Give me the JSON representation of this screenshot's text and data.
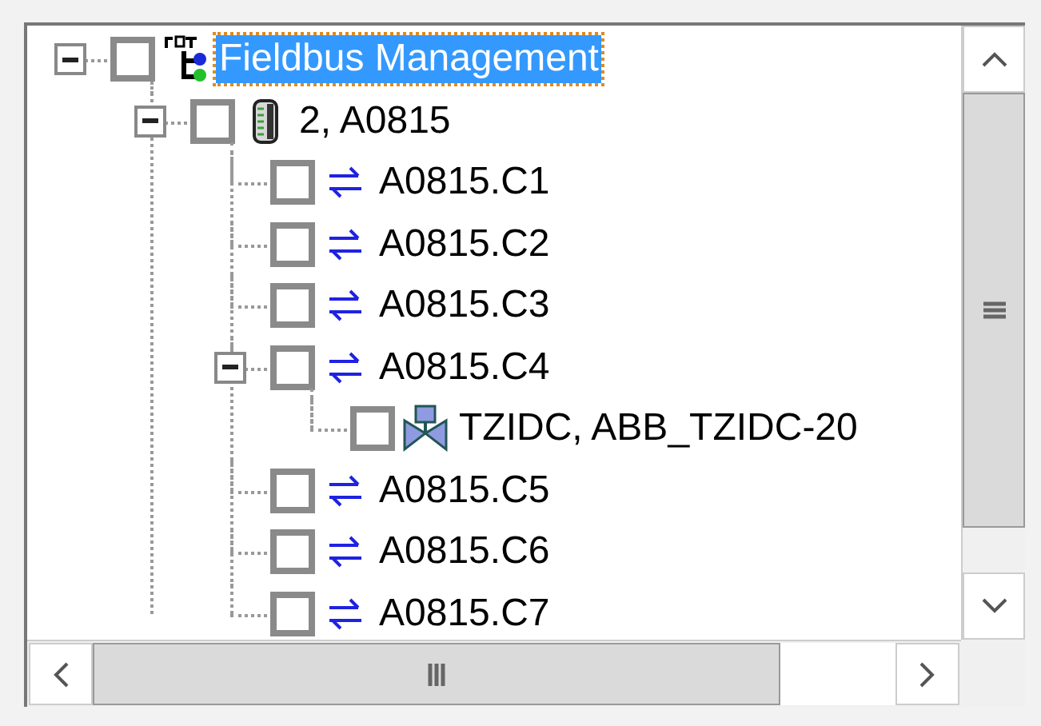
{
  "tree": [
    {
      "label": "Fieldbus Management",
      "kind": "fdt",
      "checked": false,
      "selected": true,
      "expanded": true,
      "children": [
        {
          "label": "2, A0815",
          "kind": "rack",
          "checked": false,
          "selected": false,
          "expanded": true,
          "children": [
            {
              "label": "A0815.C1",
              "kind": "channel",
              "checked": false,
              "selected": false
            },
            {
              "label": "A0815.C2",
              "kind": "channel",
              "checked": false,
              "selected": false
            },
            {
              "label": "A0815.C3",
              "kind": "channel",
              "checked": false,
              "selected": false
            },
            {
              "label": "A0815.C4",
              "kind": "channel",
              "checked": false,
              "selected": false,
              "expanded": true,
              "children": [
                {
                  "label": "TZIDC, ABB_TZIDC-20",
                  "kind": "valve",
                  "checked": false,
                  "selected": false
                }
              ]
            },
            {
              "label": "A0815.C5",
              "kind": "channel",
              "checked": false,
              "selected": false
            },
            {
              "label": "A0815.C6",
              "kind": "channel",
              "checked": false,
              "selected": false
            },
            {
              "label": "A0815.C7",
              "kind": "channel",
              "checked": false,
              "selected": false
            }
          ]
        }
      ]
    }
  ]
}
